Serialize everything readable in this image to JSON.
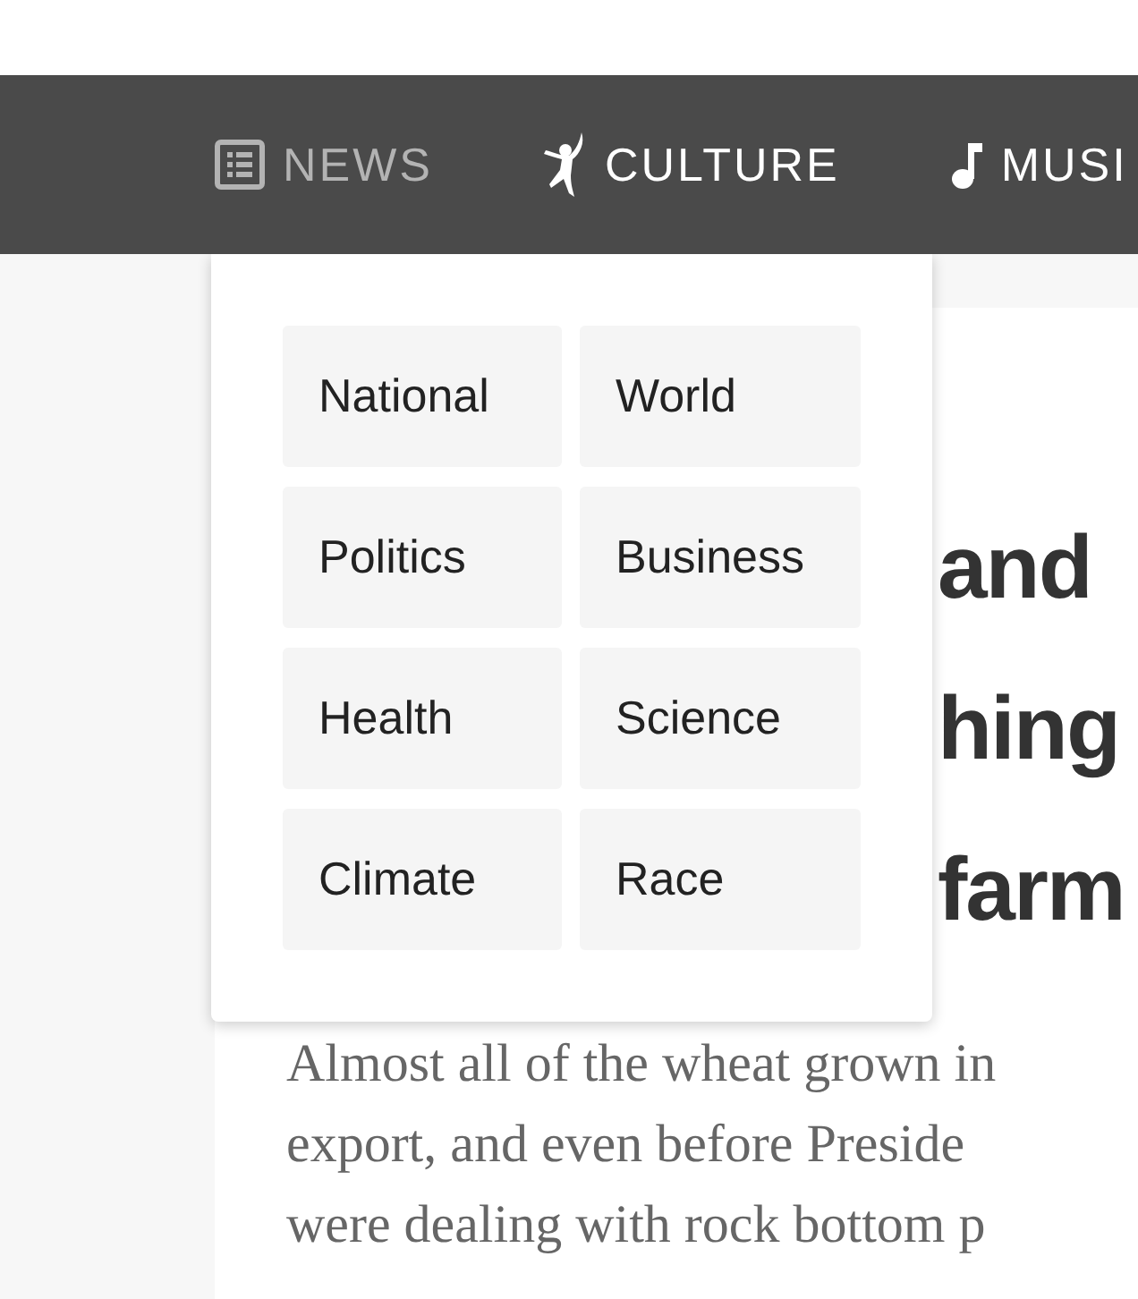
{
  "nav": {
    "items": [
      {
        "label": "NEWS",
        "selected": true
      },
      {
        "label": "CULTURE",
        "selected": false
      },
      {
        "label": "MUSI",
        "selected": false
      }
    ]
  },
  "dropdown": {
    "links": [
      "National",
      "World",
      "Politics",
      "Business",
      "Health",
      "Science",
      "Climate",
      "Race"
    ]
  },
  "article": {
    "headline_lines": [
      "and",
      "hing",
      "farm"
    ],
    "body_lines": [
      "Almost all of the wheat grown in",
      "export, and even before Preside",
      "were dealing with rock bottom p"
    ]
  }
}
